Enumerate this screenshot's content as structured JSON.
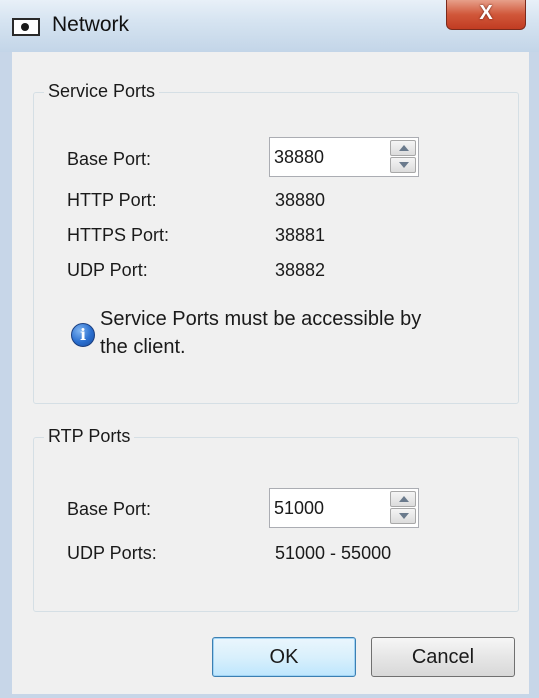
{
  "window": {
    "title": "Network",
    "close_label": "X"
  },
  "service_ports": {
    "group_label": "Service Ports",
    "base_port_label": "Base Port:",
    "base_port_value": "38880",
    "http_label": "HTTP Port:",
    "http_value": "38880",
    "https_label": "HTTPS Port:",
    "https_value": "38881",
    "udp_label": "UDP Port:",
    "udp_value": "38882",
    "info_icon": "i",
    "info_text_line1": "Service Ports must be accessible by",
    "info_text_line2": "the client."
  },
  "rtp_ports": {
    "group_label": "RTP Ports",
    "base_port_label": "Base Port:",
    "base_port_value": "51000",
    "udp_ports_label": "UDP Ports:",
    "udp_ports_value": "51000 - 55000"
  },
  "buttons": {
    "ok": "OK",
    "cancel": "Cancel"
  },
  "icons": {
    "title": "network-window-icon",
    "close": "close-icon",
    "info": "info-icon",
    "spin_up": "spin-up-arrow-icon",
    "spin_down": "spin-down-arrow-icon"
  },
  "colors": {
    "frame": "#c7d6e8",
    "client": "#f0f0f0",
    "close_button": "#c13c22",
    "default_button_border": "#3c7fb1"
  }
}
